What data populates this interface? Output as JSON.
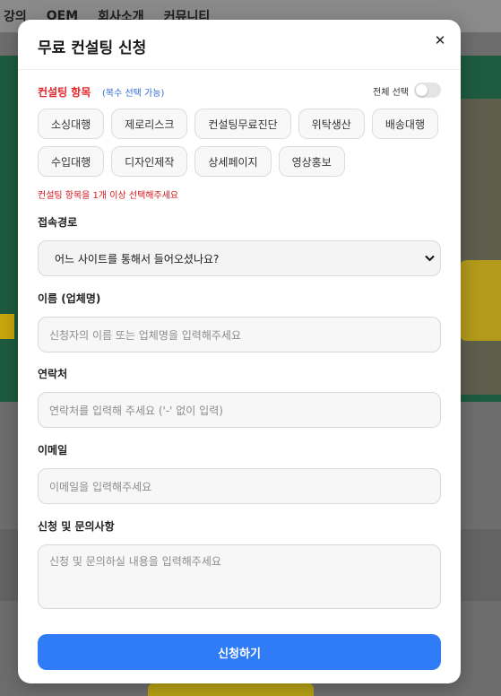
{
  "background": {
    "nav": [
      "강의",
      "OEM",
      "회사소개",
      "커뮤니티"
    ]
  },
  "modal": {
    "title": "무료 컨설팅 신청",
    "close_icon": "close-icon"
  },
  "category": {
    "label": "컨설팅 항목",
    "hint": "(복수 선택 가능)",
    "select_all": "전체 선택",
    "select_all_on": false,
    "chips": [
      "소싱대행",
      "제로리스크",
      "컨설팅무료진단",
      "위탁생산",
      "배송대행",
      "수입대행",
      "디자인제작",
      "상세페이지",
      "영상홍보"
    ],
    "error": "컨설팅 항목을 1개 이상 선택해주세요"
  },
  "source": {
    "label": "접속경로",
    "value": "어느 사이트를 통해서 들어오셨나요?"
  },
  "name": {
    "label": "이름 (업체명)",
    "placeholder": "신청자의 이름 또는 업체명을 입력해주세요"
  },
  "phone": {
    "label": "연락처",
    "placeholder": "연락처를 입력해 주세요 ('-' 없이 입력)"
  },
  "email": {
    "label": "이메일",
    "placeholder": "이메일을 입력해주세요"
  },
  "inquiry": {
    "label": "신청 및 문의사항",
    "placeholder": "신청 및 문의하실 내용을 입력해주세요"
  },
  "submit_label": "신청하기",
  "colors": {
    "accent": "#2f7cf6",
    "required": "#e0262a",
    "hint": "#2f6bd8"
  }
}
